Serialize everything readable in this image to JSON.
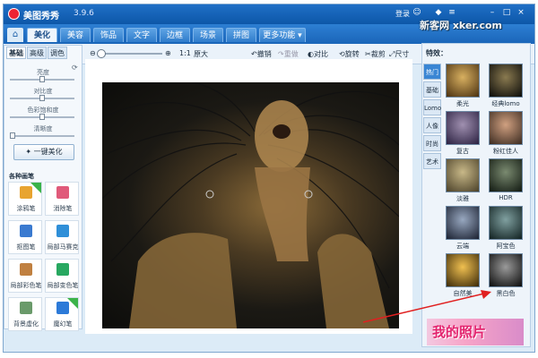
{
  "app": {
    "title": "美图秀秀",
    "version": "3.9.6",
    "login": "登录"
  },
  "watermark": "新客网 xker.com",
  "main_tabs": [
    {
      "label": "美化",
      "active": true
    },
    {
      "label": "美容"
    },
    {
      "label": "饰品"
    },
    {
      "label": "文字"
    },
    {
      "label": "边框"
    },
    {
      "label": "场景"
    },
    {
      "label": "拼图"
    },
    {
      "label": "更多功能"
    }
  ],
  "toolbar": {
    "zoom_ratio": "1:1",
    "zoom_label": "原大",
    "undo": "撤销",
    "redo": "重做",
    "compare": "对比",
    "rotate": "旋转",
    "crop": "裁剪",
    "resize": "尺寸"
  },
  "left_panel": {
    "tabs": [
      {
        "label": "基础",
        "active": true
      },
      {
        "label": "高级"
      },
      {
        "label": "调色"
      }
    ],
    "sliders": [
      {
        "label": "亮度",
        "value": 0.5
      },
      {
        "label": "对比度",
        "value": 0.5
      },
      {
        "label": "色彩饱和度",
        "value": 0.5
      },
      {
        "label": "清晰度",
        "value": 0.0
      }
    ],
    "one_click_button": "一键美化",
    "section_title": "各种画笔",
    "tools": [
      {
        "label": "涂鸦笔",
        "icon": "brush-icon",
        "color": "#e8a430",
        "new": true
      },
      {
        "label": "消除笔",
        "icon": "eraser-icon",
        "color": "#e05a7a"
      },
      {
        "label": "抠图笔",
        "icon": "cutout-icon",
        "color": "#3a7ad0"
      },
      {
        "label": "局部马赛克",
        "icon": "mosaic-icon",
        "color": "#2f8fd8"
      },
      {
        "label": "局部彩色笔",
        "icon": "color-brush-icon",
        "color": "#c08040"
      },
      {
        "label": "局部变色笔",
        "icon": "recolor-brush-icon",
        "color": "#28a860"
      },
      {
        "label": "背景虚化",
        "icon": "blur-icon",
        "color": "#6a9a6a"
      },
      {
        "label": "魔幻笔",
        "icon": "magic-wand-icon",
        "color": "#2c7ad8",
        "new": true
      }
    ]
  },
  "right_panel": {
    "title": "特效：",
    "tabs": [
      {
        "label": "热门",
        "active": true
      },
      {
        "label": "基础"
      },
      {
        "label": "Lomo"
      },
      {
        "label": "人像"
      },
      {
        "label": "时尚"
      },
      {
        "label": "艺术"
      }
    ],
    "effects": [
      {
        "label": "柔光",
        "color": "#b08a40"
      },
      {
        "label": "经典lomo",
        "color": "#3a3a2a"
      },
      {
        "label": "复古",
        "color": "#6a5a7a"
      },
      {
        "label": "粉红佳人",
        "color": "#a07a5a"
      },
      {
        "label": "淡雅",
        "color": "#9a8a5a"
      },
      {
        "label": "HDR",
        "color": "#3a4a40"
      },
      {
        "label": "云端",
        "color": "#5a6a80"
      },
      {
        "label": "阿宝色",
        "color": "#4a6a6a"
      },
      {
        "label": "自然美",
        "color": "#c0902a"
      },
      {
        "label": "黑白色",
        "color": "#2a2a2a"
      }
    ]
  },
  "banner": {
    "text": "我的照片"
  }
}
